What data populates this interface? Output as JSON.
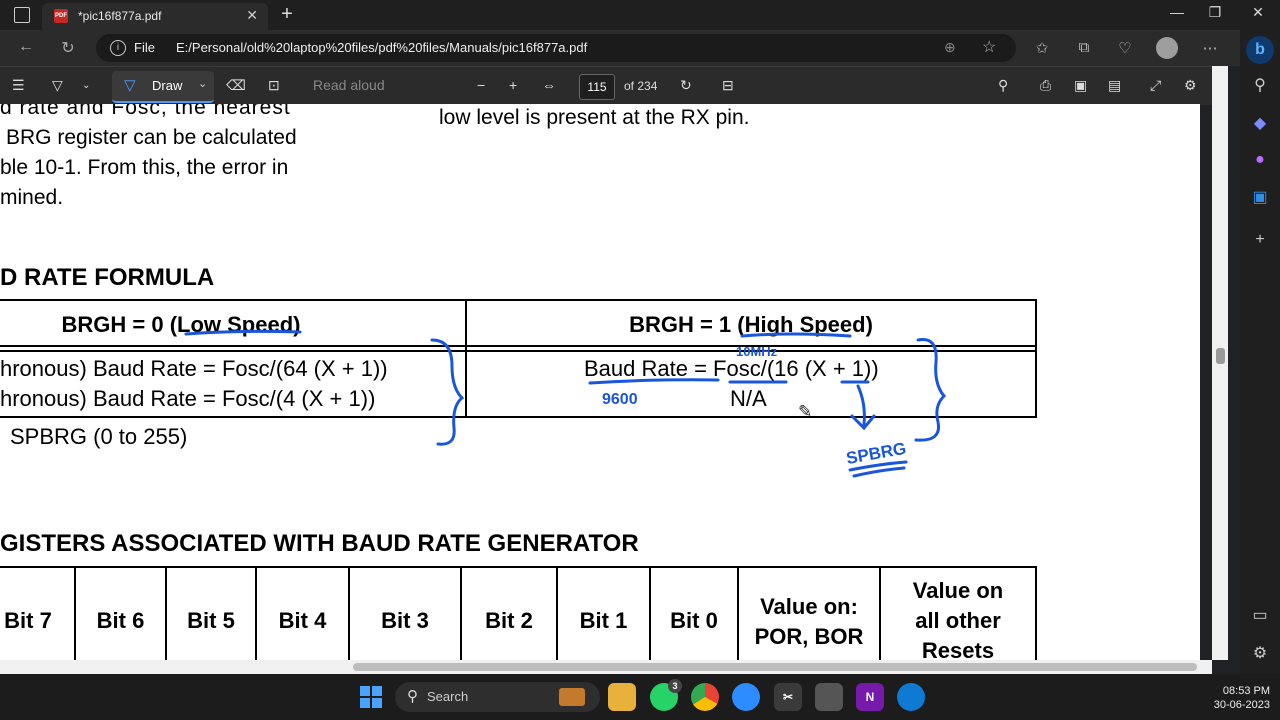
{
  "browser": {
    "tab_title": "*pic16f877a.pdf",
    "tab_icon_label": "PDF",
    "address_label": "File",
    "address_path": "E:/Personal/old%20laptop%20files/pdf%20files/Manuals/pic16f877a.pdf"
  },
  "pdf_toolbar": {
    "draw_label": "Draw",
    "read_aloud_label": "Read aloud",
    "page_number": "115",
    "page_total": "of 234"
  },
  "document": {
    "left_paragraph": [
      "d rate and Fosc, the nearest",
      "BRG register can be calculated",
      "ble 10-1. From this, the error in",
      "mined."
    ],
    "right_paragraph": "low level is present at the RX pin.",
    "formula_heading": "D RATE FORMULA",
    "formula_table": {
      "col_low": "BRGH = 0 (Low Speed)",
      "col_high": "BRGH = 1 (High Speed)",
      "low_row1": "hronous) Baud Rate = Fosc/(64 (X + 1))",
      "low_row2": "hronous) Baud Rate = Fosc/(4 (X + 1))",
      "high_row1": "Baud Rate = Fosc/(16 (X + 1))",
      "high_row2": "N/A"
    },
    "footnote": "SPBRG (0 to 255)",
    "registers_heading": "GISTERS ASSOCIATED WITH BAUD RATE GENERATOR",
    "register_headers": [
      "Bit 7",
      "Bit 6",
      "Bit 5",
      "Bit 4",
      "Bit 3",
      "Bit 2",
      "Bit 1",
      "Bit 0"
    ],
    "value_por": [
      "Value on:",
      "POR, BOR"
    ],
    "value_other": [
      "Value on",
      "all other",
      "Resets"
    ]
  },
  "annotations": {
    "note_fosc": "10MHz",
    "note_9600": "9600",
    "note_spbrg": "SPBRG",
    "ink_color": "#1a56db"
  },
  "taskbar": {
    "search_label": "Search",
    "whatsapp_badge": "3",
    "time": "08:53 PM",
    "date": "30-06-2023"
  }
}
